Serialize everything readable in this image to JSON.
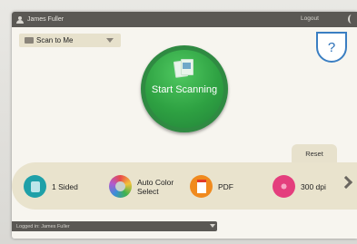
{
  "topbar": {
    "user_name": "James Fuller",
    "logout_label": "Logout"
  },
  "workflow": {
    "selected": "Scan to Me"
  },
  "help": {
    "label": "?"
  },
  "start": {
    "label": "Start Scanning"
  },
  "reset_label": "Reset",
  "options": [
    {
      "label": "1 Sided",
      "icon": "page-icon",
      "color": "#1fa0a8"
    },
    {
      "label": "Auto Color Select",
      "icon": "color-wheel-icon",
      "color": "#f2c23a"
    },
    {
      "label": "PDF",
      "icon": "pdf-icon",
      "color": "#f08a1e"
    },
    {
      "label": "300 dpi",
      "icon": "resolution-icon",
      "color": "#e43e7d"
    }
  ],
  "status": {
    "text": "Logged in: James Fuller"
  },
  "colors": {
    "topbar": "#5a5854",
    "start_button": "#2ea142",
    "accent_blue": "#2a6fb8",
    "panel": "#e9e3cd"
  }
}
